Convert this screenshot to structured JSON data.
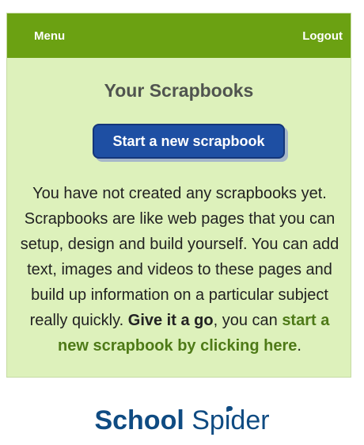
{
  "nav": {
    "menu_label": "Menu",
    "logout_label": "Logout"
  },
  "page": {
    "title": "Your Scrapbooks",
    "start_button_label": "Start a new scrapbook",
    "intro": {
      "text": "You have not created any scrapbooks yet. Scrapbooks are like web pages that you can setup, design and build yourself. You can add text, images and videos to these pages and build up information on a particular subject really quickly.",
      "give_it_a_go": "Give it a go",
      "comma": ", you can",
      "link_text": "start a new scrapbook by clicking here",
      "period": "."
    }
  },
  "brand": {
    "part1": "School",
    "part2": "Sp",
    "part3": "i",
    "part4": "der"
  },
  "colors": {
    "topbar": "#6ba112",
    "panel_bg": "#ddf1bb",
    "button_bg": "#1e4fa3",
    "link_green": "#4e7a17",
    "brand_blue": "#0f4b82"
  }
}
